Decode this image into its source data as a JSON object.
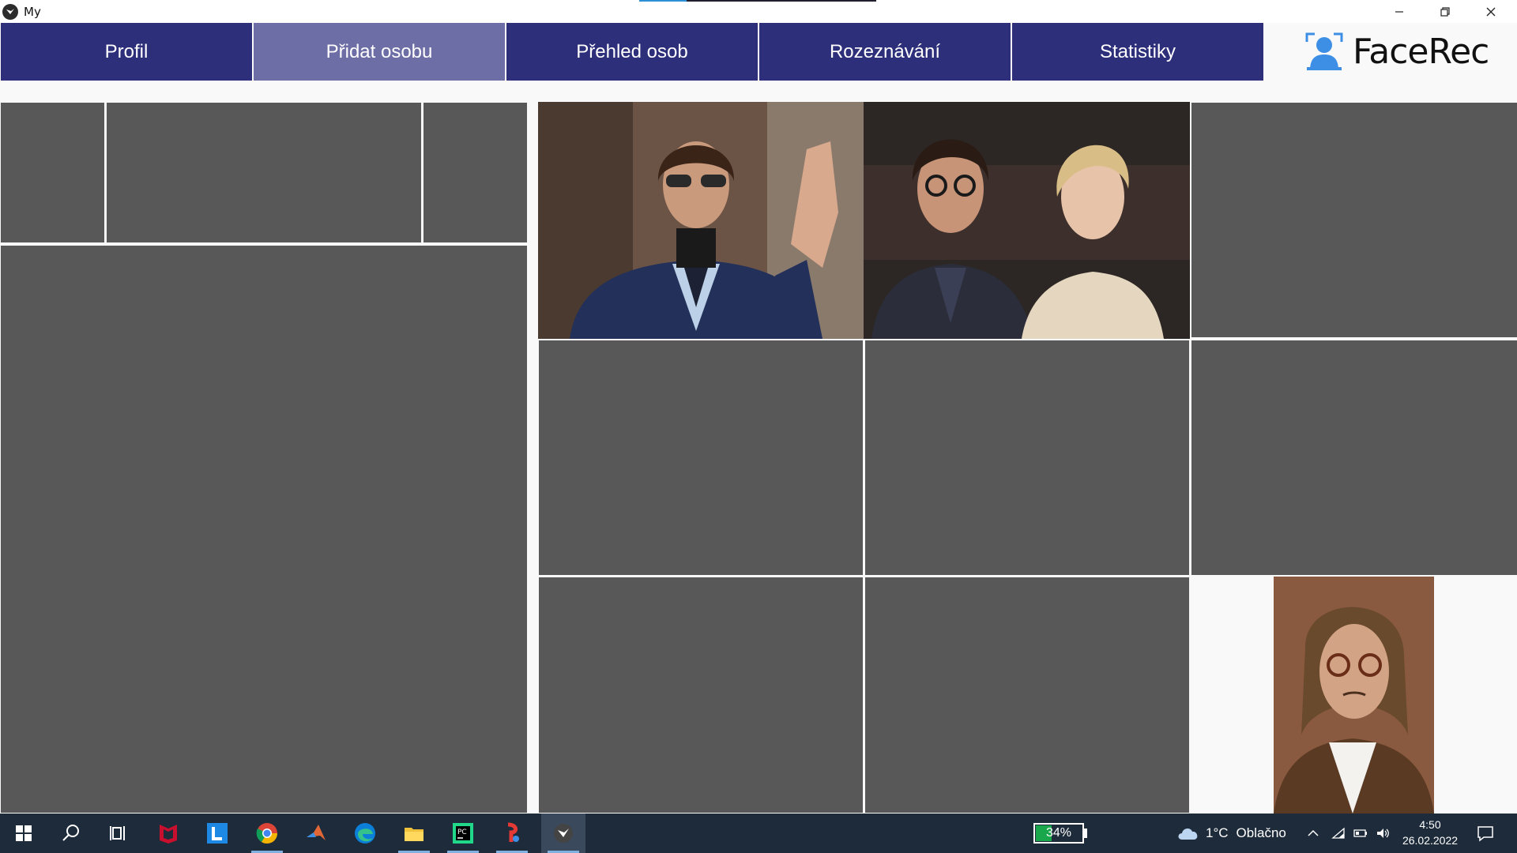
{
  "window": {
    "title": "My"
  },
  "nav": {
    "tabs": [
      {
        "label": "Profil",
        "active": false
      },
      {
        "label": "Přidat osobu",
        "active": true
      },
      {
        "label": "Přehled osob",
        "active": false
      },
      {
        "label": "Rozeznávání",
        "active": false
      },
      {
        "label": "Statistiky",
        "active": false
      }
    ],
    "logo_text": "FaceRec"
  },
  "colors": {
    "nav_tab": "#2e2f7b",
    "nav_tab_active": "#6e6ea6",
    "tile": "#585858",
    "taskbar": "#1d2b3a",
    "logo_accent": "#3d8fe6"
  },
  "taskbar": {
    "apps": [
      "windows-start",
      "search",
      "task-view",
      "mcafee",
      "l-app",
      "chrome",
      "matlab",
      "edge",
      "file-explorer",
      "pycharm",
      "paint-app",
      "kivy-app"
    ],
    "battery_percent": "34%",
    "battery_level": 0.34,
    "weather_temp": "1°C",
    "weather_desc": "Oblačno",
    "time": "4:50",
    "date": "26.02.2022"
  }
}
